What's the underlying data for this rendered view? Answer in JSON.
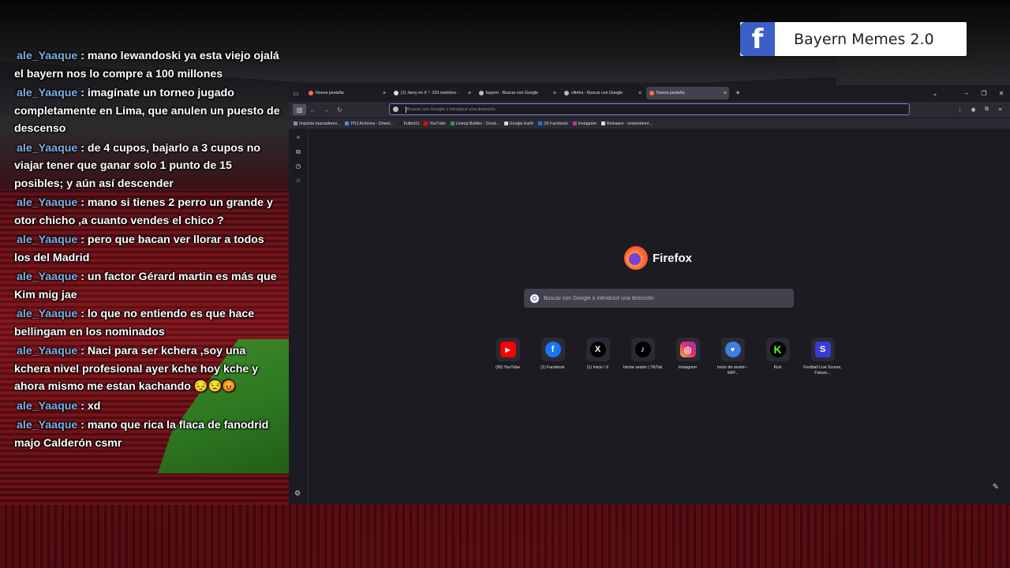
{
  "badge": {
    "text": "Bayern Memes 2.0",
    "logo": "f"
  },
  "chat": [
    {
      "user": "ale_Yaaque",
      "text": "mano lewandoski ya esta viejo ojalá el bayern nos lo compre a 100 millones"
    },
    {
      "user": "ale_Yaaque",
      "text": "imagínate un torneo jugado completamente en Lima, que anulen un puesto de descenso"
    },
    {
      "user": "ale_Yaaque",
      "text": "de 4 cupos, bajarlo a 3 cupos no viajar tener que ganar solo 1 punto de 15 posibles; y aún así descender"
    },
    {
      "user": "ale_Yaaque",
      "text": "mano si tienes 2 perro un grande y otor chicho ,a cuanto vendes el chico ?"
    },
    {
      "user": "ale_Yaaque",
      "text": "pero que bacan ver llorar a todos los del Madrid"
    },
    {
      "user": "ale_Yaaque",
      "text": "un factor Gérard martin es más que Kim mig jae"
    },
    {
      "user": "ale_Yaaque",
      "text": "lo que no entiendo es que hace bellingam en los nominados"
    },
    {
      "user": "ale_Yaaque",
      "text": "Naci para ser kchera ,soy una kchera nivel profesional ayer kche hoy kche y ahora mismo me estan kachando 😔😒😡"
    },
    {
      "user": "ale_Yaaque",
      "text": "xd"
    },
    {
      "user": "ale_Yaaque",
      "text": "mano que rica la flaca de fanodrid majo Calderón csmr"
    }
  ],
  "browser": {
    "tabs": [
      {
        "label": "Nueva pestaña",
        "color": "#ff7139",
        "close": "×"
      },
      {
        "label": "(1) Jarvy en X \"- 103 matches -",
        "color": "#dddddd",
        "close": "×"
      },
      {
        "label": "bayern - Buscar con Google",
        "color": "#bbbbbb",
        "close": "×"
      },
      {
        "label": "vitinha - Buscar con Google",
        "color": "#bbbbbb",
        "close": "×"
      },
      {
        "label": "Nueva pestaña",
        "color": "#ff7139",
        "close": "×"
      }
    ],
    "new_tab": "+",
    "url_placeholder": "Buscar con Google o introducir una dirección",
    "bookmarks": [
      {
        "label": "Importar marcadores...",
        "color": "#8f8f9d"
      },
      {
        "label": "PS3 Archives - Downl...",
        "color": "#4a90d9"
      },
      {
        "label": "Futbol11",
        "color": "#222222"
      },
      {
        "label": "YouTube",
        "color": "#ff0000"
      },
      {
        "label": "Lineup Builder - Creat...",
        "color": "#2e9e44"
      },
      {
        "label": "Google Earth",
        "color": "#dddddd"
      },
      {
        "label": "(9) Facebook",
        "color": "#1877f2"
      },
      {
        "label": "Instagram",
        "color": "#d6249f"
      },
      {
        "label": "Releases · serpentiem/...",
        "color": "#dddddd"
      }
    ],
    "brand": "Firefox",
    "search_placeholder": "Buscar con Google o introducir una dirección",
    "shortcuts": [
      {
        "label": "(90) YouTube",
        "glyph": "▶",
        "color": "#ff0000"
      },
      {
        "label": "(1) Facebook",
        "glyph": "f",
        "color": "#1877f2"
      },
      {
        "label": "(1) Inicio / X",
        "glyph": "X",
        "color": "#000000"
      },
      {
        "label": "Iniciar sesión | TikTok",
        "glyph": "♪",
        "color": "#000000"
      },
      {
        "label": "Instagram",
        "glyph": "◎",
        "color": "#d6249f"
      },
      {
        "label": "Inicio de sesión - SAP...",
        "glyph": "♥",
        "color": "#3f7fe0"
      },
      {
        "label": "Kick",
        "glyph": "K",
        "color": "#53fc18"
      },
      {
        "label": "Football Live Scores, Fixture...",
        "glyph": "S",
        "color": "#3b3bd4"
      }
    ]
  }
}
